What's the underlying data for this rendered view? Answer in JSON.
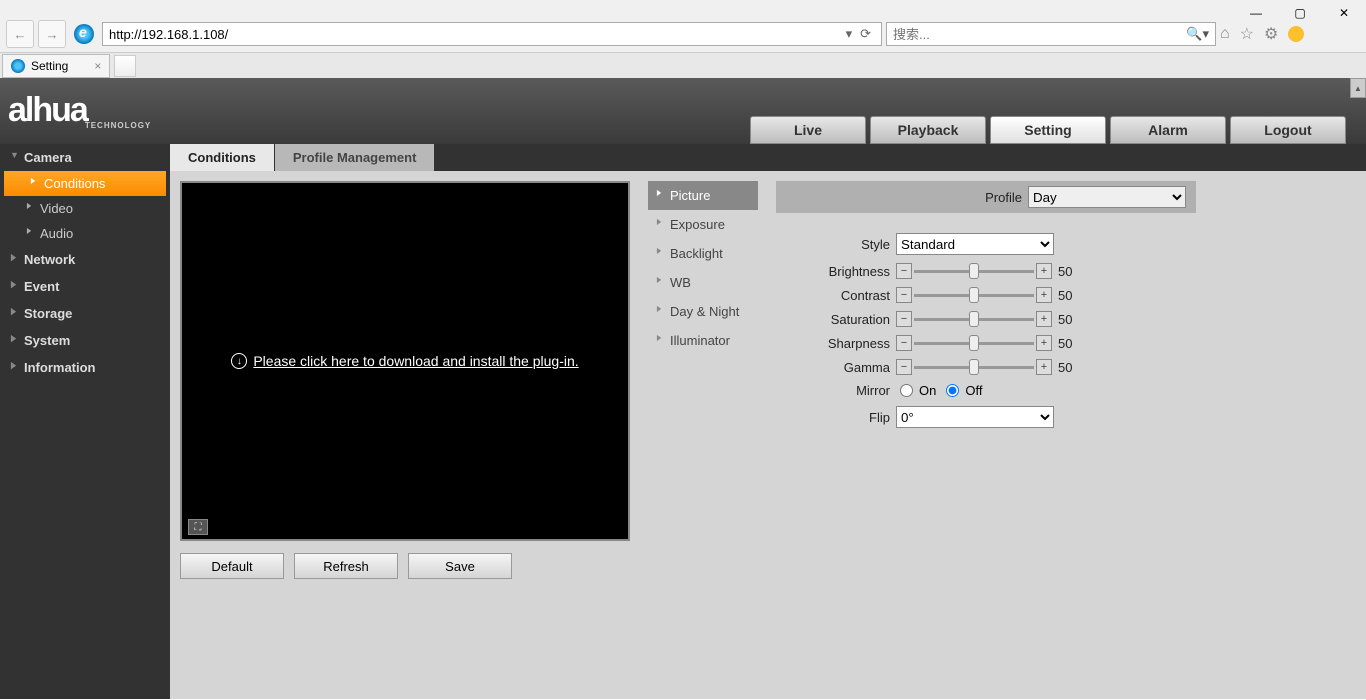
{
  "browser": {
    "url": "http://192.168.1.108/",
    "search_placeholder": "搜索...",
    "tab_title": "Setting"
  },
  "logo": {
    "brand": "alhua",
    "sub": "TECHNOLOGY"
  },
  "main_nav": [
    "Live",
    "Playback",
    "Setting",
    "Alarm",
    "Logout"
  ],
  "main_nav_active": 2,
  "sidebar": {
    "groups": [
      {
        "label": "Camera",
        "expanded": true,
        "subs": [
          "Conditions",
          "Video",
          "Audio"
        ],
        "active_sub": 0
      },
      {
        "label": "Network",
        "expanded": false
      },
      {
        "label": "Event",
        "expanded": false
      },
      {
        "label": "Storage",
        "expanded": false
      },
      {
        "label": "System",
        "expanded": false
      },
      {
        "label": "Information",
        "expanded": false
      }
    ]
  },
  "sub_tabs": [
    "Conditions",
    "Profile Management"
  ],
  "sub_tab_active": 0,
  "preview": {
    "plugin_text": "Please click here to download and install the plug-in."
  },
  "action_buttons": [
    "Default",
    "Refresh",
    "Save"
  ],
  "categories": [
    "Picture",
    "Exposure",
    "Backlight",
    "WB",
    "Day & Night",
    "Illuminator"
  ],
  "category_active": 0,
  "profile": {
    "label": "Profile",
    "value": "Day"
  },
  "controls": {
    "style": {
      "label": "Style",
      "value": "Standard"
    },
    "sliders": [
      {
        "label": "Brightness",
        "value": 50
      },
      {
        "label": "Contrast",
        "value": 50
      },
      {
        "label": "Saturation",
        "value": 50
      },
      {
        "label": "Sharpness",
        "value": 50
      },
      {
        "label": "Gamma",
        "value": 50
      }
    ],
    "mirror": {
      "label": "Mirror",
      "on": "On",
      "off": "Off",
      "value": "Off"
    },
    "flip": {
      "label": "Flip",
      "value": "0°"
    }
  }
}
